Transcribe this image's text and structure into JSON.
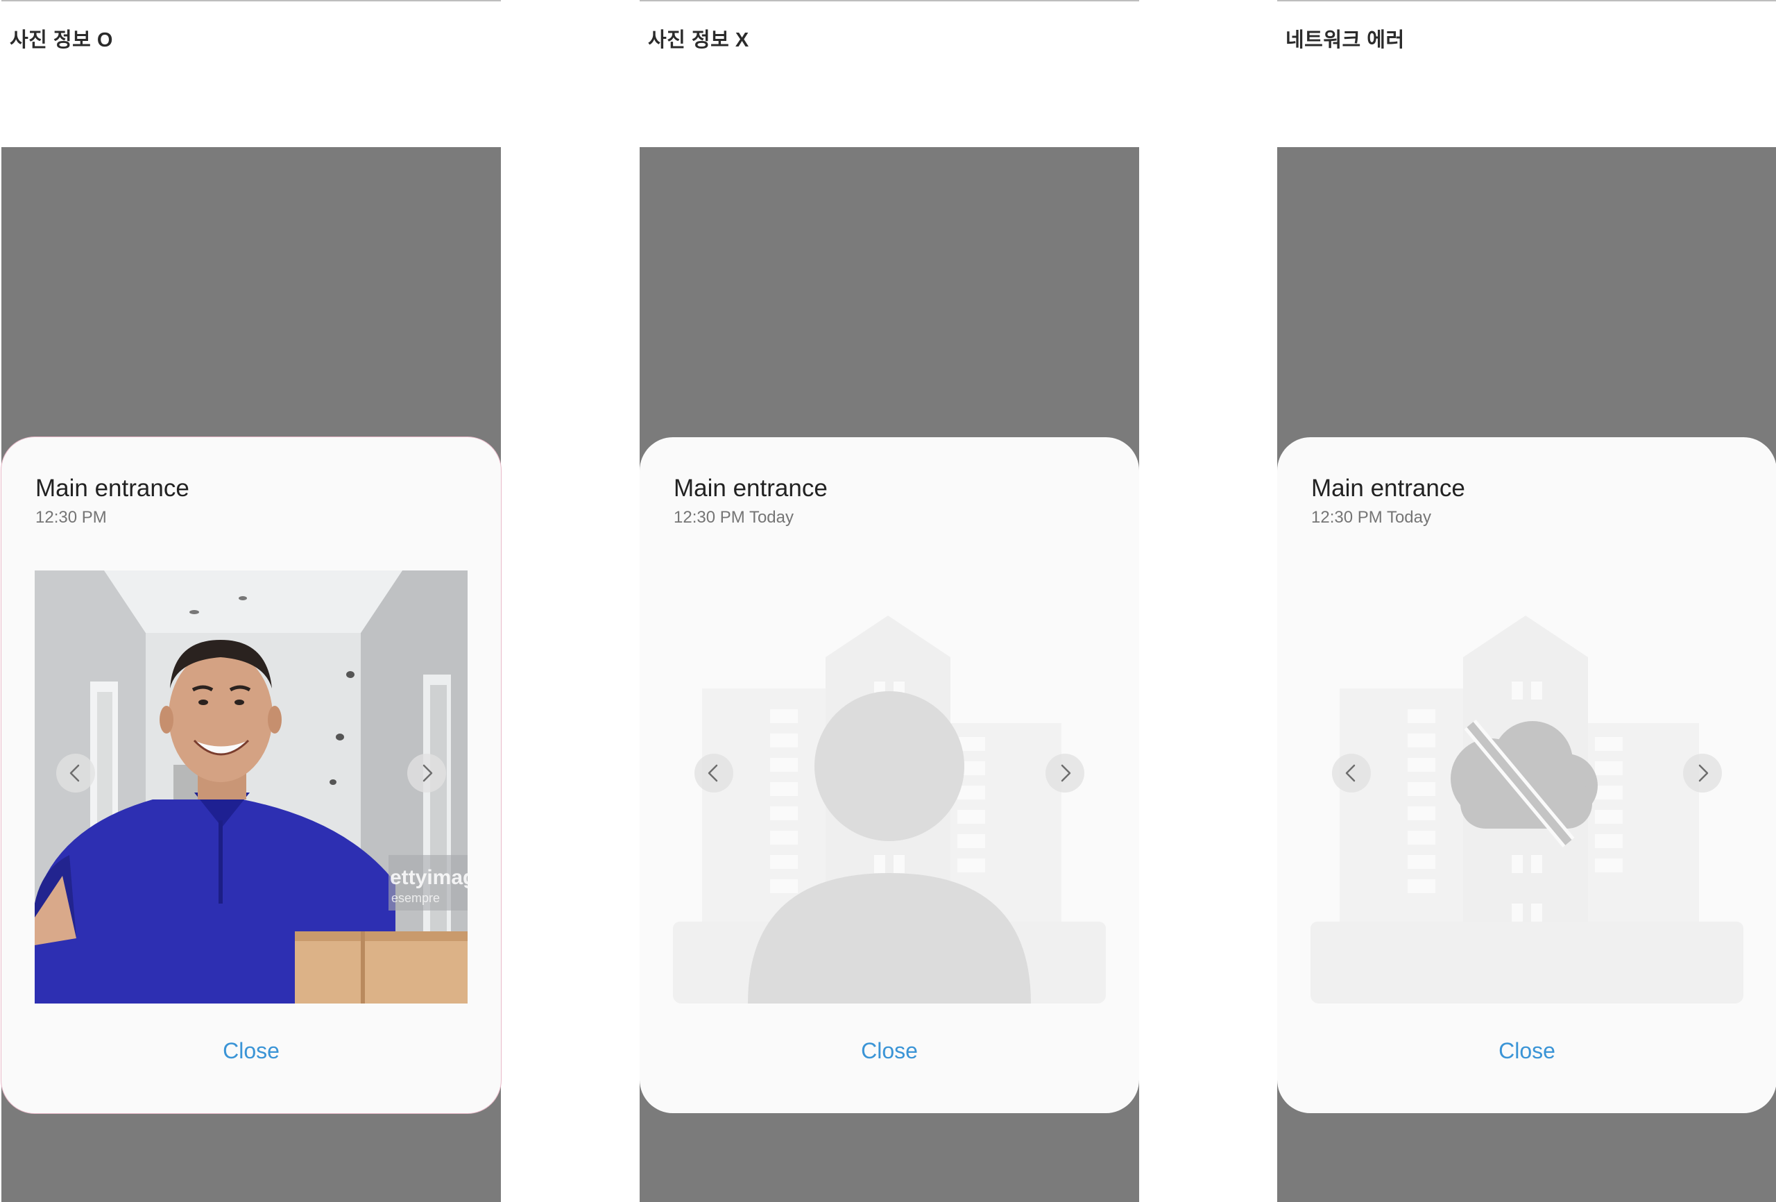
{
  "panels": [
    {
      "label": "사진 정보 O",
      "dialog": {
        "title": "Main entrance",
        "time": "12:30 PM",
        "close_label": "Close"
      },
      "media": {
        "state": "photo",
        "icon": "visitor-photo",
        "watermark": "ettyimag",
        "watermark_sub": "esempre"
      }
    },
    {
      "label": "사진 정보 X",
      "dialog": {
        "title": "Main entrance",
        "time": "12:30 PM Today",
        "close_label": "Close"
      },
      "media": {
        "state": "no-photo",
        "icon": "person-placeholder-icon"
      }
    },
    {
      "label": "네트워크 에러",
      "dialog": {
        "title": "Main entrance",
        "time": "12:30 PM Today",
        "close_label": "Close"
      },
      "media": {
        "state": "network-error",
        "icon": "cloud-off-icon"
      }
    }
  ],
  "colors": {
    "backdrop": "#7b7b7b",
    "dialog_bg": "#fafafa",
    "accent": "#3a94d6",
    "placeholder": "#dcdcdc",
    "uniform": "#2d2fb2"
  },
  "icons": {
    "prev": "chevron-left-icon",
    "next": "chevron-right-icon"
  }
}
